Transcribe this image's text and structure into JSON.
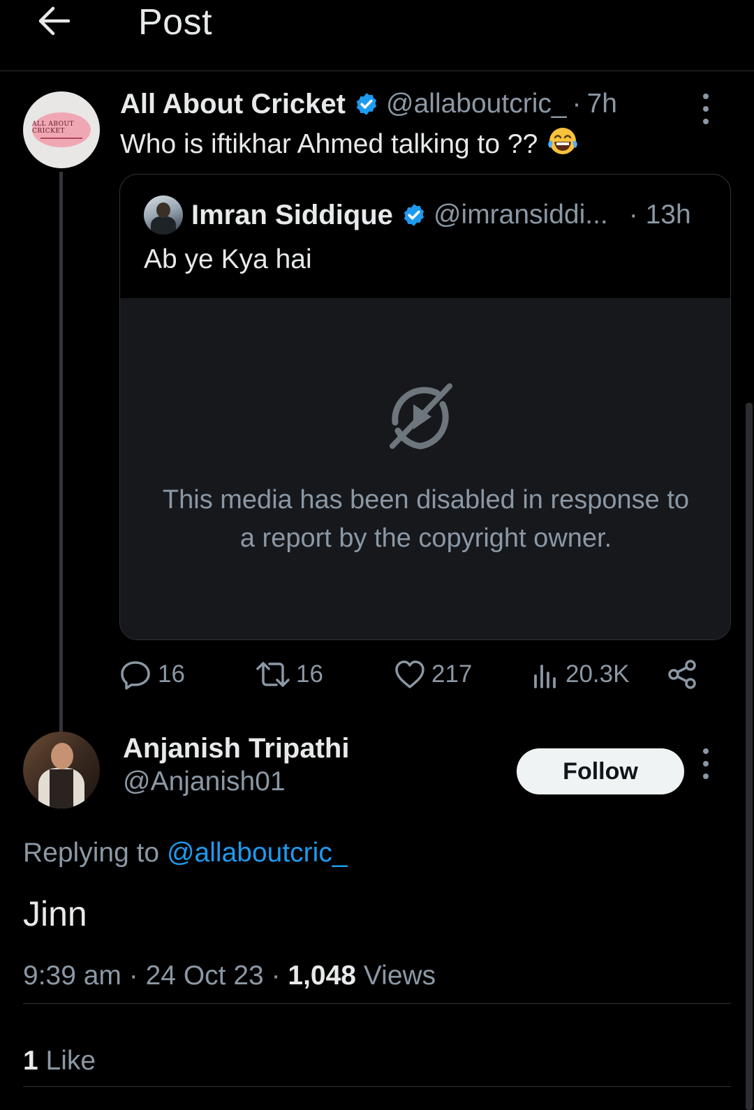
{
  "header": {
    "title": "Post"
  },
  "original_post": {
    "author_name": "All About Cricket",
    "handle": "@allaboutcric_",
    "separator": "·",
    "time": "7h",
    "text": "Who is iftikhar Ahmed talking to ??",
    "avatar_logo_text": "ALL ABOUT CRICKET"
  },
  "quoted_post": {
    "author_name": "Imran Siddique",
    "handle": "@imransiddi...",
    "time": "· 13h",
    "text": "Ab ye Kya hai",
    "media_notice_line1": "This media has been disabled in response to",
    "media_notice_line2": "a report by the copyright owner."
  },
  "actions": {
    "replies": "16",
    "reposts": "16",
    "likes": "217",
    "views": "20.3K"
  },
  "reply": {
    "author_name": "Anjanish Tripathi",
    "handle": "@Anjanish01",
    "follow_label": "Follow",
    "replying_to_prefix": "Replying to",
    "replying_to_handle": "@allaboutcric_",
    "text": "Jinn",
    "time": "9:39 am",
    "date": "24 Oct 23",
    "views_count": "1,048",
    "views_label": "Views",
    "meta_separator": "·",
    "like_count": "1",
    "like_label": "Like"
  },
  "colors": {
    "background": "#000000",
    "text_primary": "#e7e9ea",
    "text_secondary": "#8b98a5",
    "accent": "#1d9bf0",
    "border": "#2f3336"
  },
  "icons": [
    "back-arrow-icon",
    "verified-badge-icon",
    "more-icon",
    "laughing-emoji-icon",
    "media-disabled-icon",
    "reply-icon",
    "repost-icon",
    "like-icon",
    "views-icon",
    "share-icon"
  ]
}
